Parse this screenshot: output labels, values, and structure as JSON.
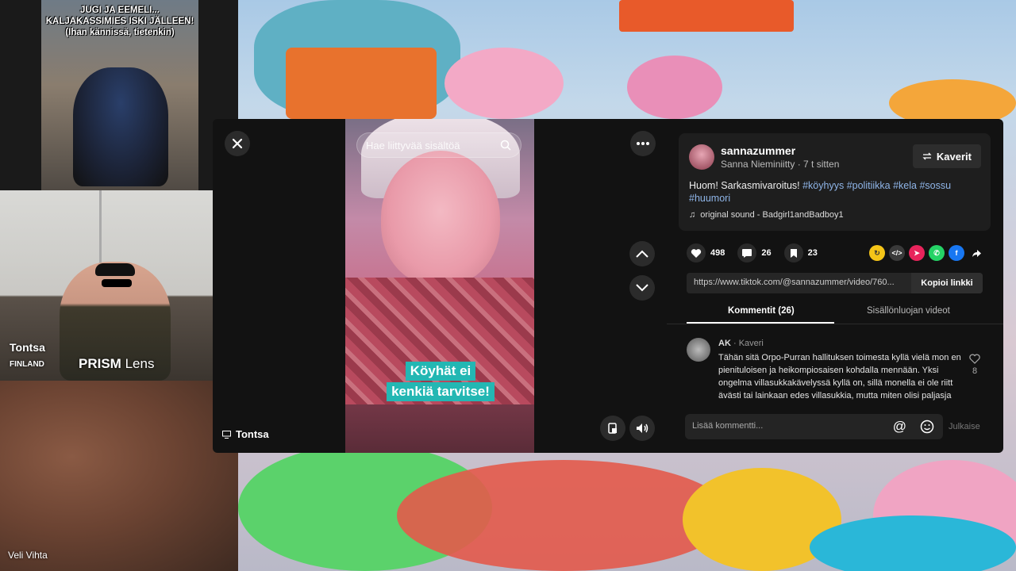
{
  "meme": {
    "caption_lines": [
      "JUGI JA EEMELI...",
      "KALJAKASSIMIES ISKI JÄLLEEN!",
      "(Ihan kännissä, tietenkin)"
    ]
  },
  "participants": {
    "tontsa": {
      "name": "Tontsa",
      "country": "FINLAND",
      "lens_brand": "PRISM",
      "lens_suffix": "Lens"
    },
    "veli": {
      "name": "Veli Vihta"
    }
  },
  "modal": {
    "close_icon": "close-icon",
    "more_icon": "ellipsis-icon",
    "search_placeholder": "Hae liittyvää sisältöä",
    "caption_lines": [
      "Köyhät ei",
      "kenkiä tarvitse!"
    ],
    "screen_share_label": "Tontsa",
    "post": {
      "username": "sannazummer",
      "display_name": "Sanna Nieminiitty",
      "time_ago": "7 t sitten",
      "friends_label": "Kaverit",
      "description_lead": "Huom! Sarkasmivaroitus!",
      "hashtags": [
        "#köyhyys",
        "#politiikka",
        "#kela",
        "#sossu",
        "#huumori"
      ],
      "sound": "original sound - Badgirl1andBadboy1",
      "likes": "498",
      "comments": "26",
      "saves": "23",
      "share_colors": [
        "#f5c518",
        "#3a3a3a",
        "#e8245b",
        "#25d366",
        "#1877f2"
      ],
      "link_url": "https://www.tiktok.com/@sannazummer/video/760...",
      "copy_link_label": "Kopioi linkki",
      "tab_comments": "Kommentit (26)",
      "tab_creator_videos": "Sisällönluojan videot"
    },
    "comment": {
      "author": "AK",
      "author_badge": "Kaveri",
      "text": "Tähän sitä Orpo-Purran hallituksen toimesta kyllä vielä mon en pienituloisen ja heikompiosaisen kohdalla mennään. Yksi ongelma villasukkakävelyssä kyllä on, sillä monella ei ole riitt ävästi tai lainkaan edes villasukkia, mutta miten olisi paljasja",
      "likes": "8"
    },
    "add_comment_placeholder": "Lisää kommentti...",
    "publish_label": "Julkaise"
  }
}
